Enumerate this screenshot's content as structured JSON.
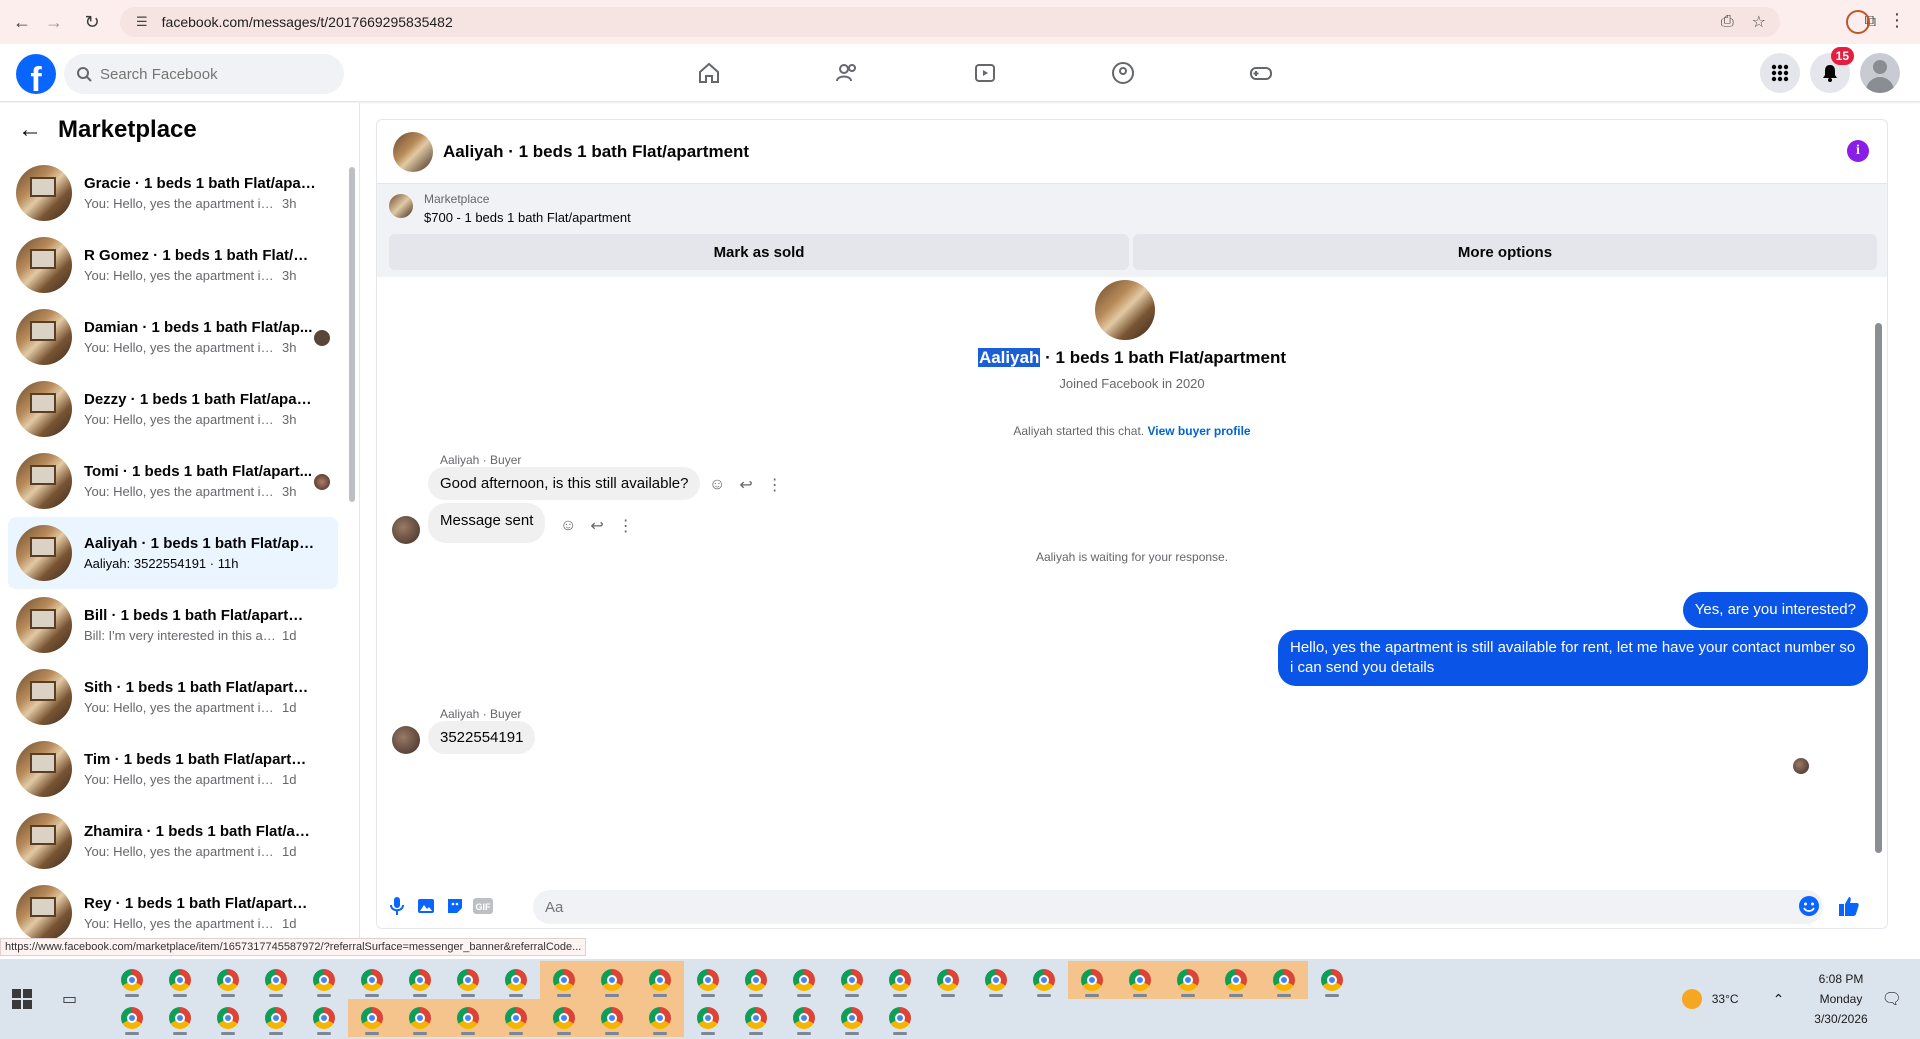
{
  "browser": {
    "url": "facebook.com/messages/t/2017669295835482"
  },
  "fb": {
    "search_placeholder": "Search Facebook",
    "notif_count": "15",
    "logo": "f"
  },
  "left": {
    "title": "Marketplace",
    "conversations": [
      {
        "name": "Gracie · 1 beds 1 bath Flat/apart...",
        "msg": "You: Hello, yes the apartment is still...",
        "time": "3h"
      },
      {
        "name": "R Gomez · 1 beds 1 bath Flat/apa...",
        "msg": "You: Hello, yes the apartment is still...",
        "time": "3h"
      },
      {
        "name": "Damian · 1 beds 1 bath Flat/ap...",
        "msg": "You: Hello, yes the apartment is ...",
        "time": "3h"
      },
      {
        "name": "Dezzy · 1 beds 1 bath Flat/apart...",
        "msg": "You: Hello, yes the apartment is still...",
        "time": "3h"
      },
      {
        "name": "Tomi · 1 beds 1 bath Flat/apart...",
        "msg": "You: Hello, yes the apartment is ...",
        "time": "3h"
      },
      {
        "name": "Aaliyah · 1 beds 1 bath Flat/apart...",
        "msg": "Aaliyah: 3522554191 · 11h",
        "time": ""
      },
      {
        "name": "Bill · 1 beds 1 bath Flat/apartment",
        "msg": "Bill: I'm very interested in this apart...",
        "time": "1d"
      },
      {
        "name": "Sith · 1 beds 1 bath Flat/apartment",
        "msg": "You: Hello, yes the apartment is still...",
        "time": "1d"
      },
      {
        "name": "Tim · 1 beds 1 bath Flat/apartment",
        "msg": "You: Hello, yes the apartment is still...",
        "time": "1d"
      },
      {
        "name": "Zhamira · 1 beds 1 bath Flat/apa...",
        "msg": "You: Hello, yes the apartment is still...",
        "time": "1d"
      },
      {
        "name": "Rey · 1 beds 1 bath Flat/apartment",
        "msg": "You: Hello, yes the apartment is still...",
        "time": "1d"
      }
    ]
  },
  "chat": {
    "title": "Aaliyah · 1 beds 1 bath Flat/apartment",
    "listing_label": "Marketplace",
    "listing_title": "$700 - 1 beds 1 bath Flat/apartment",
    "mark_sold": "Mark as sold",
    "more_options": "More options",
    "profile_name_highlight": "Aaliyah",
    "profile_name_rest": " · 1 beds 1 bath Flat/apartment",
    "profile_joined": "Joined Facebook in 2020",
    "started_text": "Aaliyah started this chat. ",
    "view_buyer": "View buyer profile",
    "sender_label": "Aaliyah · Buyer",
    "msg1": "Good afternoon, is this still available?",
    "msg2": "Message sent",
    "waiting": "Aaliyah is waiting for your response.",
    "out1": "Yes, are you interested?",
    "out2": "Hello, yes the apartment is still available for rent, let me have your contact number so i can send you details",
    "sender_label2": "Aaliyah · Buyer",
    "msg3": "3522554191",
    "composer_placeholder": "Aa"
  },
  "status_url": "https://www.facebook.com/marketplace/item/1657317745587972/?referralSurface=messenger_banner&referralCode...",
  "taskbar": {
    "weather": "33°C",
    "time": "6:08 PM",
    "day": "Monday",
    "date": "3/30/2026"
  },
  "colors": {
    "fb_blue": "#0866ff",
    "outgoing_bubble": "#0a54e8",
    "active_convo": "#ebf5ff",
    "badge_red": "#e41e3f"
  }
}
